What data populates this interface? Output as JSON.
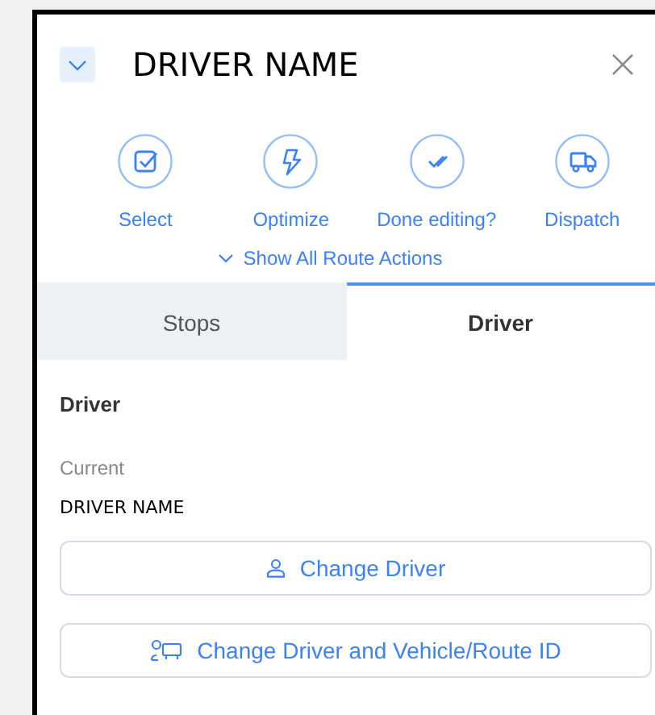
{
  "header": {
    "title": "DRIVER NAME",
    "expanded": true
  },
  "actions": [
    {
      "label": "Select"
    },
    {
      "label": "Optimize"
    },
    {
      "label": "Done editing?"
    },
    {
      "label": "Dispatch"
    }
  ],
  "show_all": {
    "label": "Show All Route Actions"
  },
  "tabs": [
    {
      "label": "Stops",
      "selected": false
    },
    {
      "label": "Driver",
      "selected": true
    }
  ],
  "section": {
    "heading": "Driver",
    "current_label": "Current",
    "current_value": "DRIVER NAME"
  },
  "buttons": [
    {
      "label": "Change Driver"
    },
    {
      "label": "Change Driver and Vehicle/Route ID"
    }
  ]
}
